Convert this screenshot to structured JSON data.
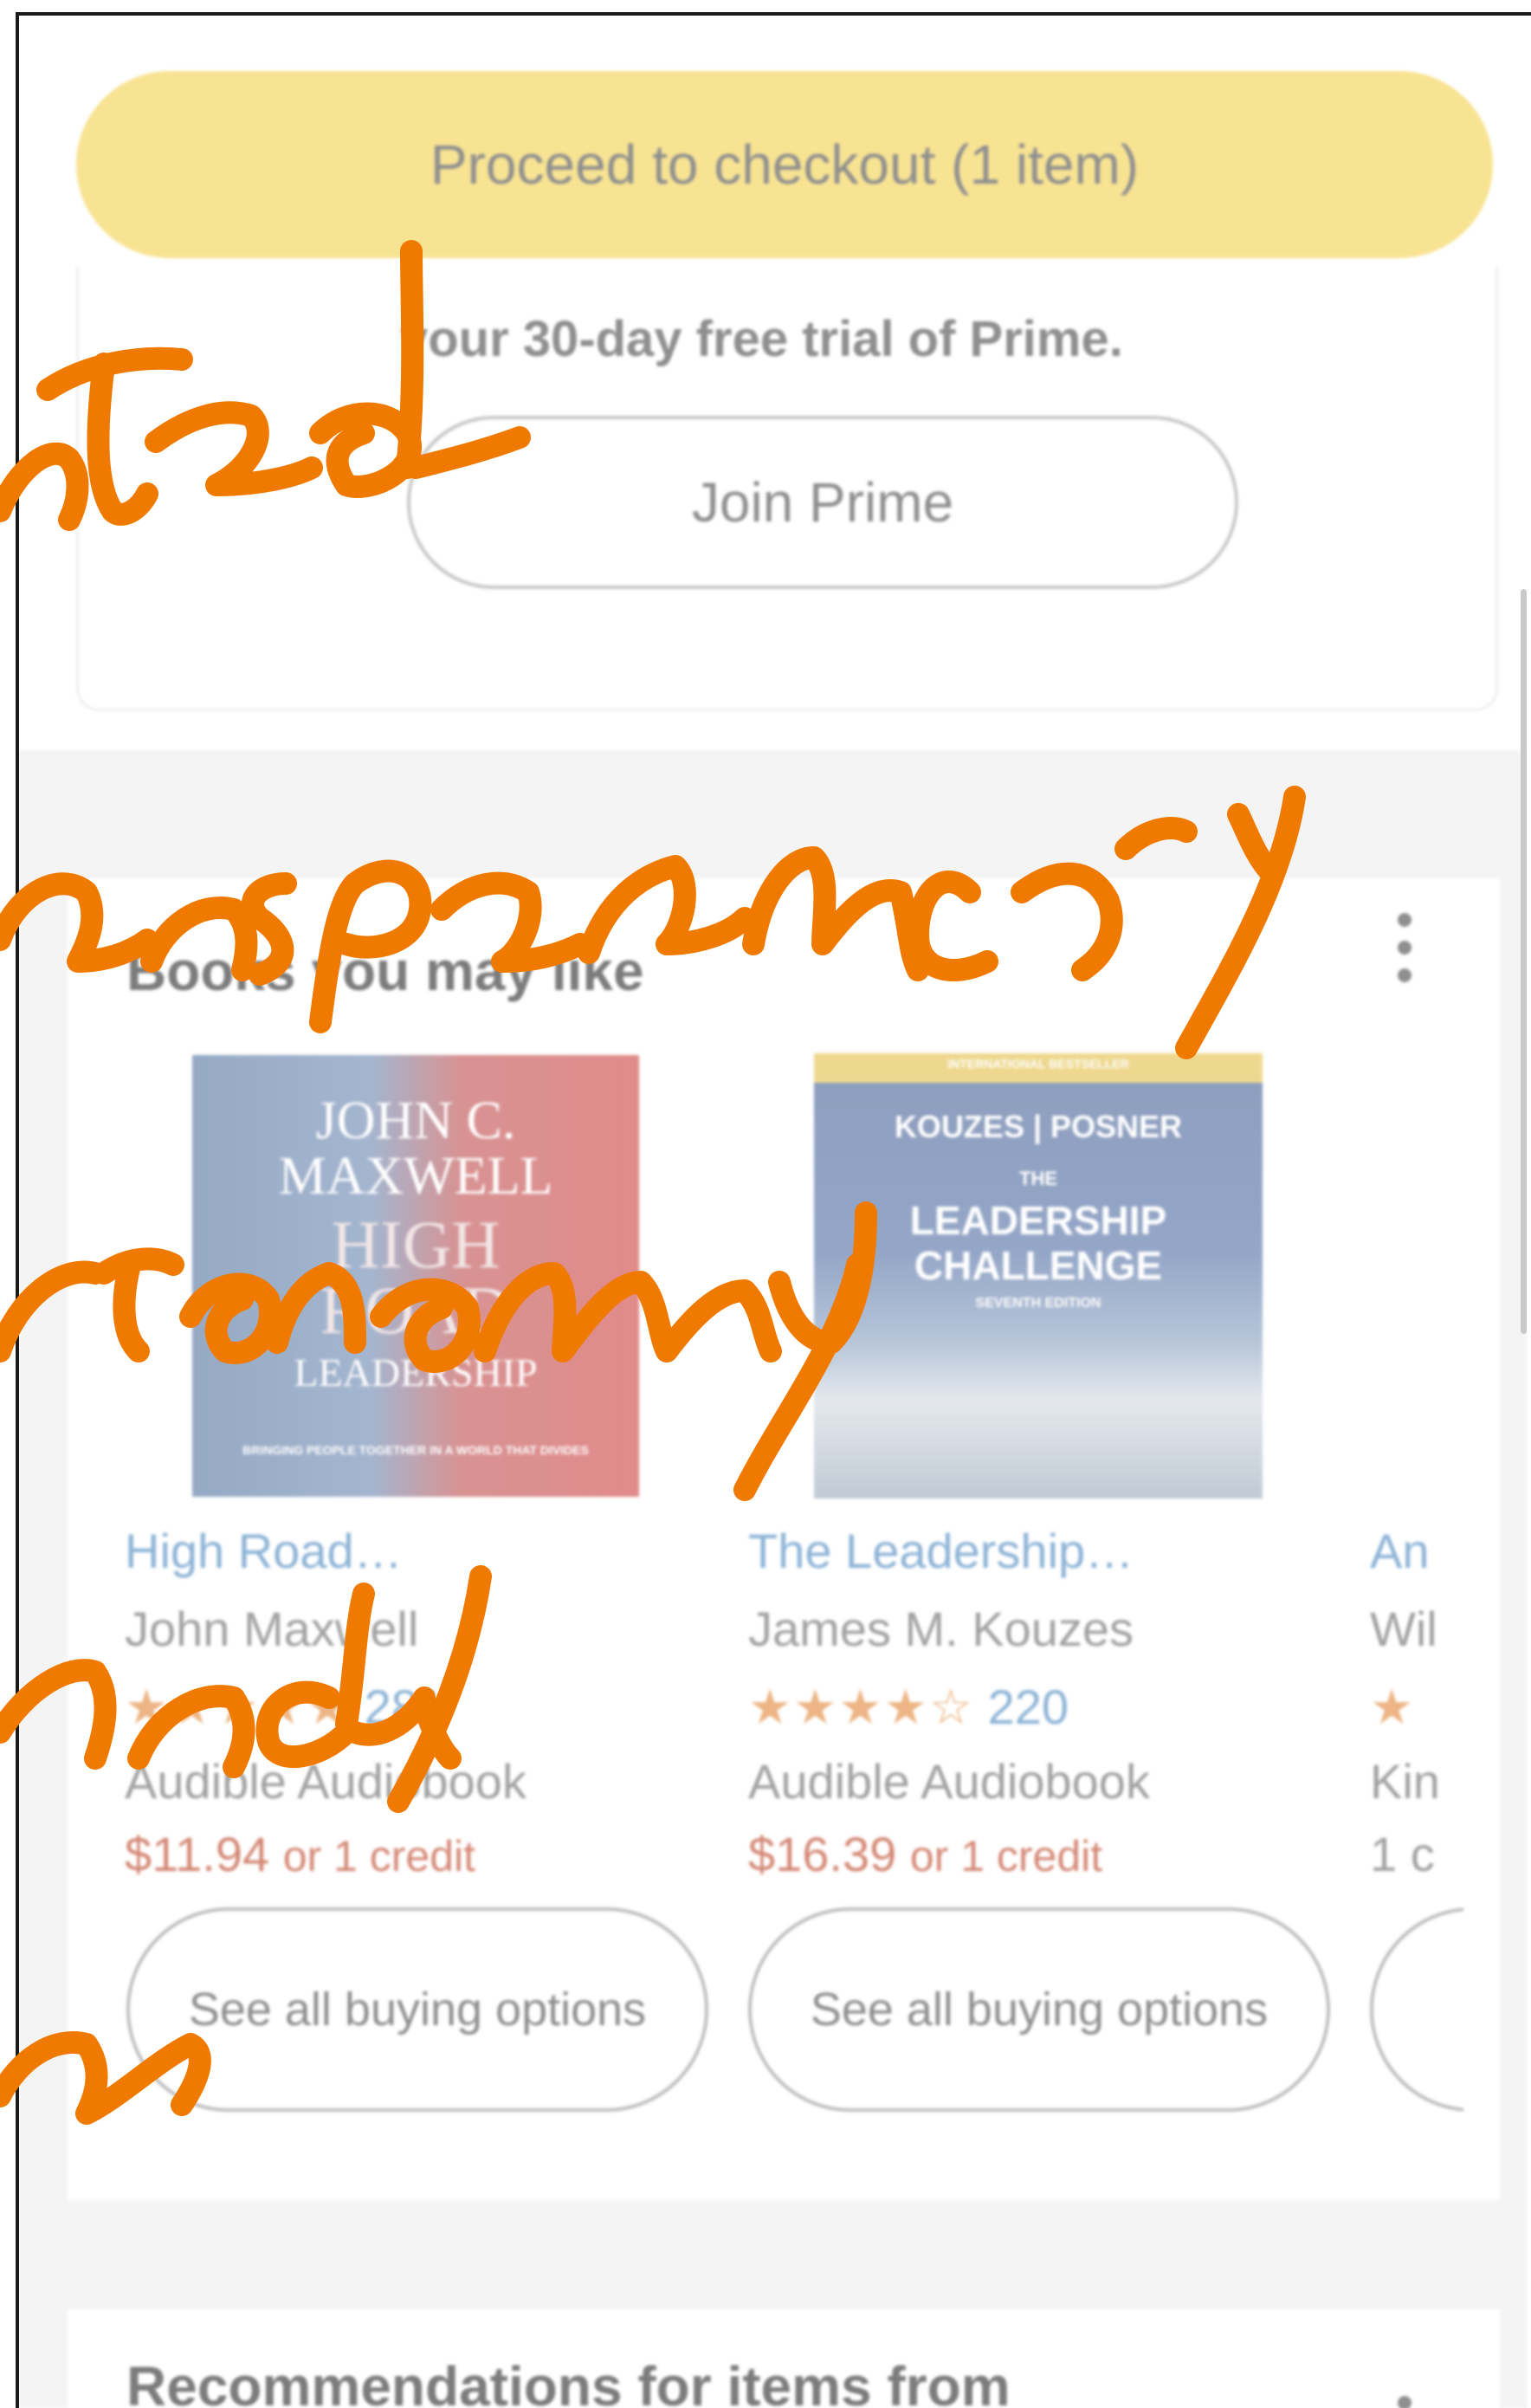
{
  "cart": {
    "checkout_button": "Proceed to checkout (1 item)"
  },
  "prime": {
    "trial_text": "your 30-day free trial of Prime.",
    "join_button": "Join Prime"
  },
  "books_section": {
    "title": "Books you may like",
    "products": [
      {
        "title": "High Road…",
        "author": "John Maxwell",
        "rating_stars": "★★★★★",
        "rating_count": "281",
        "format": "Audible Audiobook",
        "price": "$11.94",
        "credit": "or 1 credit",
        "buy_button": "See all buying options",
        "cover": {
          "line1": "JOHN C.",
          "line2": "MAXWELL",
          "line3": "HIGH",
          "line4": "ROAD",
          "line5": "LEADERSHIP",
          "tagline": "BRINGING PEOPLE TOGETHER IN A WORLD THAT DIVIDES"
        }
      },
      {
        "title": "The Leadership…",
        "author": "James M. Kouzes",
        "rating_stars": "★★★★☆",
        "rating_count": "220",
        "format": "Audible Audiobook",
        "price": "$16.39",
        "credit": "or 1 credit",
        "buy_button": "See all buying options",
        "cover": {
          "strip": "INTERNATIONAL BESTSELLER",
          "authors": "KOUZES | POSNER",
          "line1": "THE",
          "line2": "LEADERSHIP",
          "line3": "CHALLENGE",
          "edition": "SEVENTH EDITION"
        }
      },
      {
        "title": "An",
        "author": "Wil",
        "rating_stars": "★",
        "format": "Kin",
        "credit": "1 c"
      }
    ]
  },
  "next_section": {
    "title": "Recommendations for items from"
  },
  "handwriting": {
    "color": "#f07a00",
    "words": [
      "ntrol",
      "ansparency",
      "tonomy",
      "ndy",
      "n"
    ]
  }
}
